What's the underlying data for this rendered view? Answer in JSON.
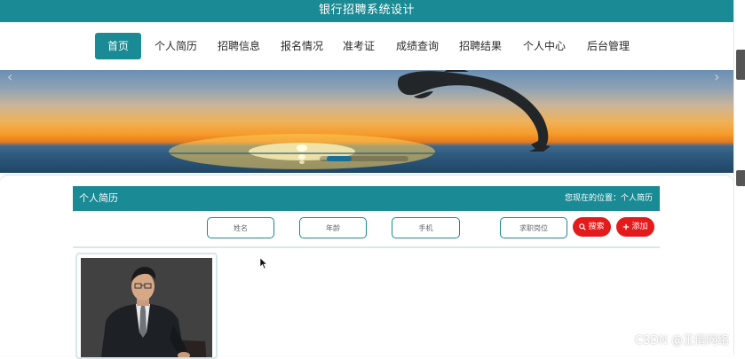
{
  "header": {
    "title": "银行招聘系统设计"
  },
  "nav": {
    "items": [
      {
        "label": "首页",
        "active": true
      },
      {
        "label": "个人简历",
        "active": false
      },
      {
        "label": "招聘信息",
        "active": false
      },
      {
        "label": "报名情况",
        "active": false
      },
      {
        "label": "准考证",
        "active": false
      },
      {
        "label": "成绩查询",
        "active": false
      },
      {
        "label": "招聘结果",
        "active": false
      },
      {
        "label": "个人中心",
        "active": false
      },
      {
        "label": "后台管理",
        "active": false
      }
    ]
  },
  "banner": {
    "prev_icon": "chevron-left-icon",
    "next_icon": "chevron-right-icon",
    "active_slide_indicator": "dot-active"
  },
  "section": {
    "title": "个人简历",
    "breadcrumb": "您现在的位置：个人简历"
  },
  "search": {
    "name_placeholder": "姓名",
    "age_placeholder": "年龄",
    "phone_placeholder": "手机",
    "position_placeholder": "求职岗位",
    "search_label": "搜索",
    "add_label": "添加"
  },
  "watermark": "CSDN @王倩网络",
  "colors": {
    "primary": "#1a8a94",
    "danger": "#e31b1b"
  }
}
